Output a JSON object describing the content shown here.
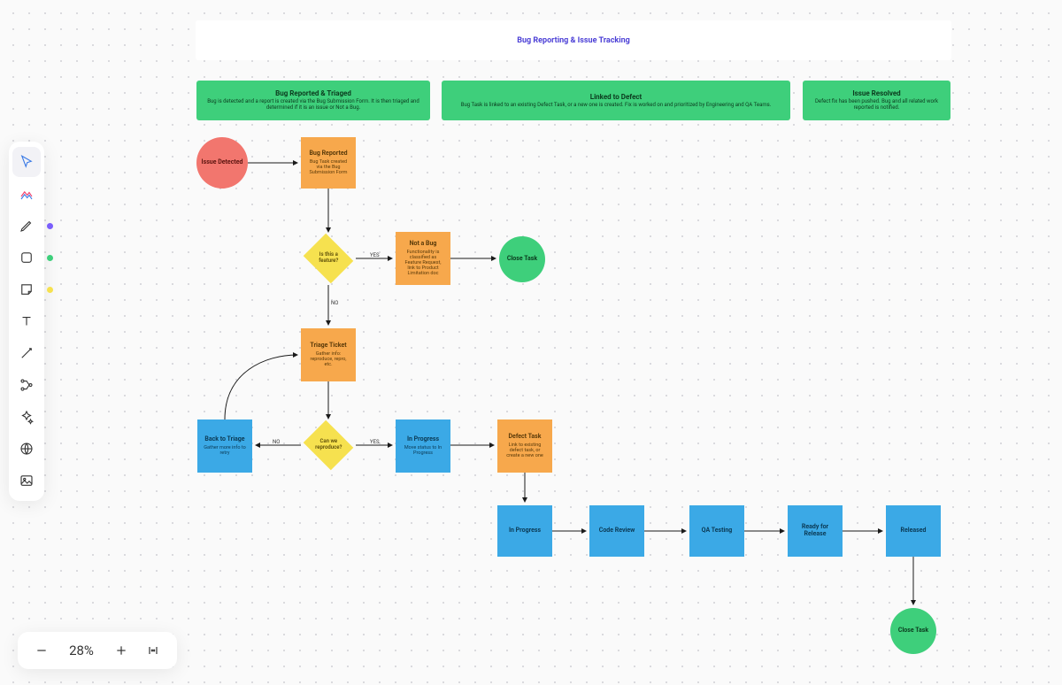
{
  "title": "Bug Reporting & Issue Tracking",
  "sections": [
    {
      "title": "Bug Reported & Triaged",
      "sub": "Bug is detected and a report is created via the Bug Submission Form. It is then triaged and determined if it is an issue or Not a Bug."
    },
    {
      "title": "Linked to Defect",
      "sub": "Bug Task is linked to an existing Defect Task, or a new one is created. Fix is worked on and prioritized by Engineering and QA Teams."
    },
    {
      "title": "Issue Resolved",
      "sub": "Defect fix has been pushed. Bug and all related work reported is notified."
    }
  ],
  "nodes": {
    "issue_detected": "Issue Detected",
    "bug_reported": {
      "t": "Bug Reported",
      "b": "Bug Task created via the Bug Submission Form"
    },
    "is_bug": "Is this a feature?",
    "not_bug": {
      "t": "Not a Bug",
      "b": "Functionality is classified as Feature Request, link to Product Limitation doc"
    },
    "close1": "Close Task",
    "triage": {
      "t": "Triage Ticket",
      "b": "Gather info: reproduce, repro, etc."
    },
    "reproduce": "Can we reproduce?",
    "back_triage": {
      "t": "Back to Triage",
      "b": "Gather more info to retry"
    },
    "in_progress1": {
      "t": "In Progress",
      "b": "Move status to In Progress"
    },
    "defect_task": {
      "t": "Defect Task",
      "b": "Link to existing defect task, or create a new one"
    },
    "in_progress2": "In Progress",
    "code_review": "Code Review",
    "qa_testing": "QA Testing",
    "ready_release": "Ready for Release",
    "released": "Released",
    "close2": "Close Task"
  },
  "edges": {
    "yes": "YES",
    "no": "NO"
  },
  "zoom": "28%",
  "colors": {
    "green": "#3ecf7b",
    "orange": "#f7a84c",
    "blue": "#3ba9e6",
    "yellow": "#f6e14f",
    "red": "#f2766e",
    "purple": "#4b3fd6"
  }
}
